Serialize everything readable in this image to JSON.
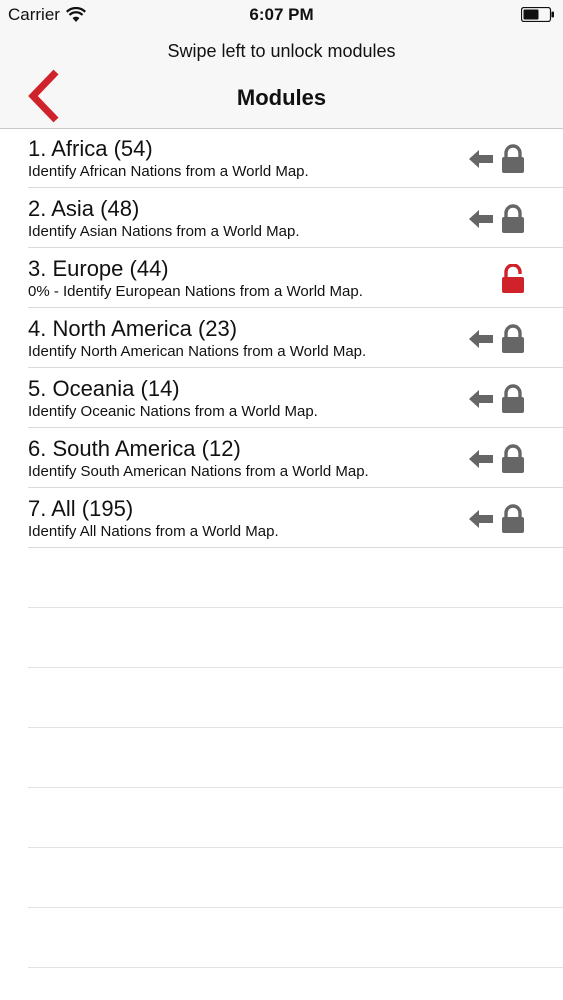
{
  "status_bar": {
    "carrier": "Carrier",
    "time": "6:07 PM"
  },
  "header": {
    "prompt": "Swipe left to unlock modules",
    "title": "Modules"
  },
  "colors": {
    "accent": "#d0222a",
    "icon_gray": "#666666"
  },
  "modules": [
    {
      "title": "1. Africa (54)",
      "subtitle": "Identify African Nations from a World Map.",
      "locked": true
    },
    {
      "title": "2. Asia (48)",
      "subtitle": "Identify Asian Nations from a World Map.",
      "locked": true
    },
    {
      "title": "3. Europe (44)",
      "subtitle": "0% - Identify European Nations from a World Map.",
      "locked": false
    },
    {
      "title": "4. North America (23)",
      "subtitle": "Identify North American Nations from a World Map.",
      "locked": true
    },
    {
      "title": "5. Oceania (14)",
      "subtitle": "Identify Oceanic Nations from a World Map.",
      "locked": true
    },
    {
      "title": "6. South America (12)",
      "subtitle": "Identify South American Nations from a World Map.",
      "locked": true
    },
    {
      "title": "7. All (195)",
      "subtitle": "Identify All Nations from a World Map.",
      "locked": true
    }
  ]
}
